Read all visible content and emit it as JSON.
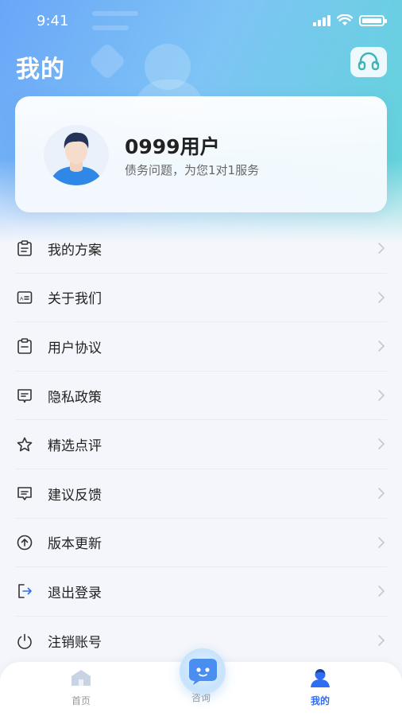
{
  "status_bar": {
    "time": "9:41"
  },
  "header": {
    "title": "我的",
    "customer_service_icon": "headset-icon"
  },
  "profile": {
    "username": "0999用户",
    "subtitle": "债务问题，为您1对1服务"
  },
  "menu": [
    {
      "label": "我的方案",
      "icon": "clipboard-icon"
    },
    {
      "label": "关于我们",
      "icon": "id-card-icon"
    },
    {
      "label": "用户协议",
      "icon": "document-icon"
    },
    {
      "label": "隐私政策",
      "icon": "shield-message-icon"
    },
    {
      "label": "精选点评",
      "icon": "star-icon"
    },
    {
      "label": "建议反馈",
      "icon": "feedback-icon"
    },
    {
      "label": "版本更新",
      "icon": "upload-circle-icon"
    },
    {
      "label": "退出登录",
      "icon": "logout-icon"
    },
    {
      "label": "注销账号",
      "icon": "power-icon"
    }
  ],
  "tabbar": {
    "home": "首页",
    "consult": "咨询",
    "mine": "我的",
    "active": "mine"
  },
  "colors": {
    "accent": "#2f6df2",
    "gradient_start": "#6aa6f8",
    "gradient_end": "#5ed6d6"
  }
}
